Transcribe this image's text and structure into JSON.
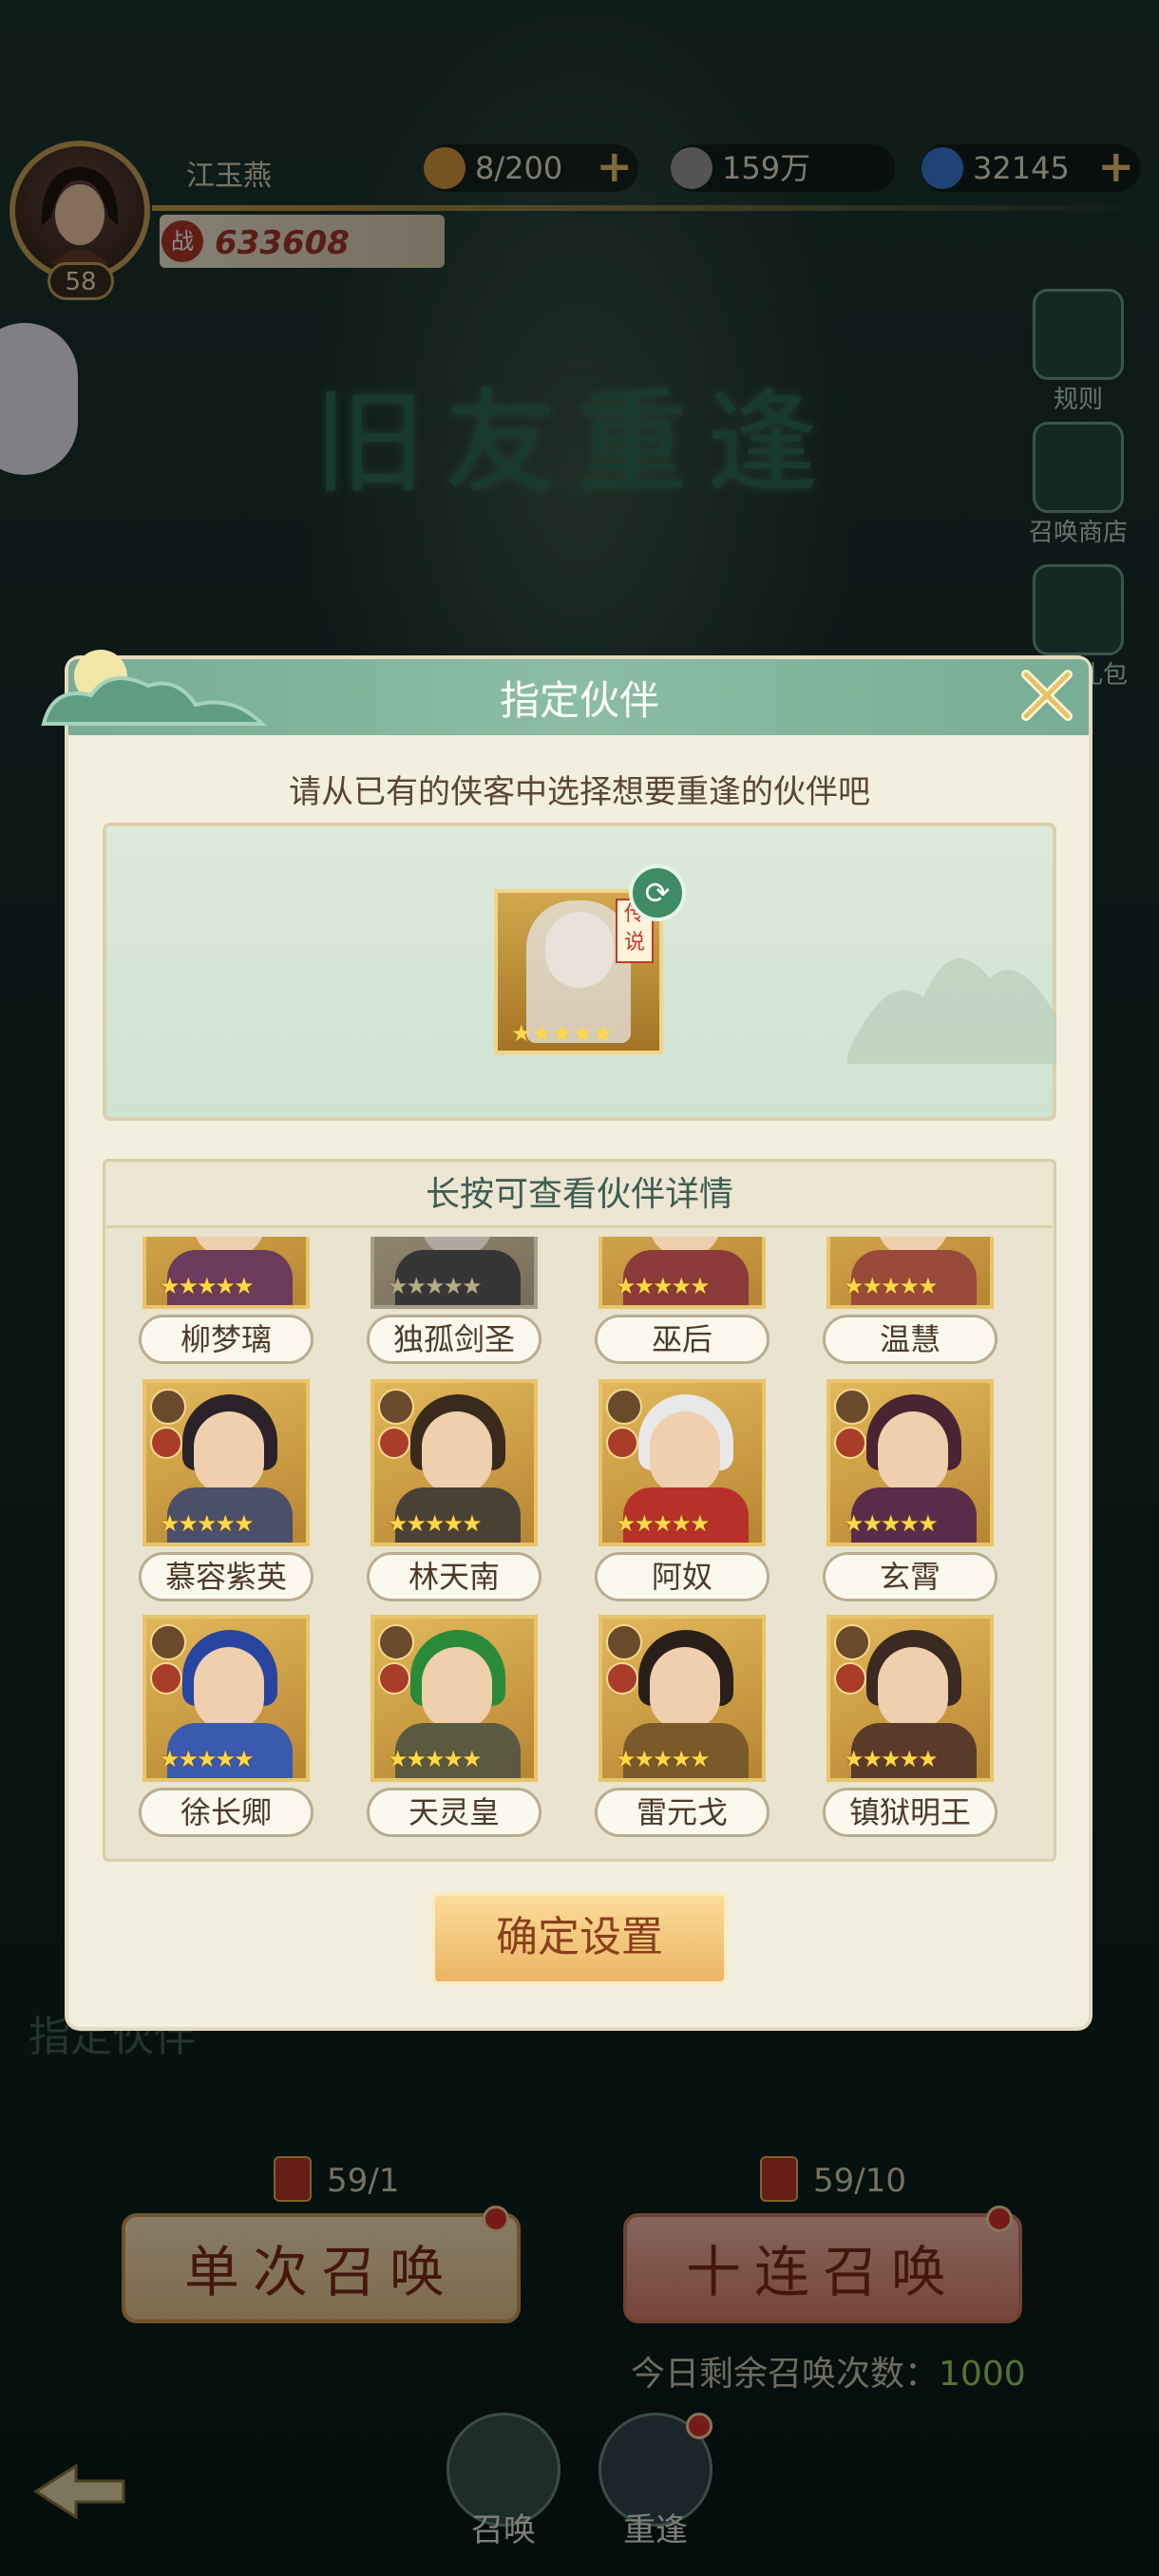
{
  "player": {
    "name": "江玉燕",
    "level": "58",
    "power": "633608",
    "power_icon": "战"
  },
  "resources": [
    {
      "id": "buns",
      "value": "8/200",
      "color": "#d89a3c"
    },
    {
      "id": "coins",
      "value": "159万",
      "color": "#9a9a9a"
    },
    {
      "id": "jade",
      "value": "32145",
      "color": "#3b7bd8"
    }
  ],
  "event_title": "旧友重逢",
  "side_menu": {
    "rules": "规则",
    "shop": "召唤商店",
    "gift": "限时礼包"
  },
  "modal": {
    "title": "指定伙伴",
    "subtitle": "请从已有的侠客中选择想要重逢的伙伴吧",
    "list_header": "长按可查看伙伴详情",
    "confirm": "确定设置",
    "legend_tag": "传说"
  },
  "partners": [
    {
      "name": "柳梦璃",
      "stars": "★★★★★",
      "legend": true,
      "hair": "#2b2330",
      "cloth": "#6c3a5c"
    },
    {
      "name": "独孤剑圣",
      "stars": "★★★★★",
      "legend": true,
      "selected": true,
      "hair": "#555",
      "cloth": "#444"
    },
    {
      "name": "巫后",
      "stars": "★★★★★",
      "legend": true,
      "hair": "#3a2a2a",
      "cloth": "#8c3a3a"
    },
    {
      "name": "温慧",
      "stars": "★★★★★",
      "legend": false,
      "hair": "#5a3522",
      "cloth": "#9a4a3a"
    },
    {
      "name": "慕容紫英",
      "stars": "★★★★★",
      "legend": false,
      "hair": "#2a2228",
      "cloth": "#4c4f6a"
    },
    {
      "name": "林天南",
      "stars": "★★★★★",
      "legend": false,
      "hair": "#3a2a1c",
      "cloth": "#4a4036"
    },
    {
      "name": "阿奴",
      "stars": "★★★★★",
      "legend": false,
      "hair": "#e8e8e8",
      "cloth": "#b8302a"
    },
    {
      "name": "玄霄",
      "stars": "★★★★★",
      "legend": false,
      "hair": "#4a2432",
      "cloth": "#5a2c4a"
    },
    {
      "name": "徐长卿",
      "stars": "★★★★★",
      "legend": false,
      "hair": "#2844a0",
      "cloth": "#3a5ab0"
    },
    {
      "name": "天灵皇",
      "stars": "★★★★★",
      "legend": false,
      "hair": "#2a8a3a",
      "cloth": "#5a5a40"
    },
    {
      "name": "雷元戈",
      "stars": "★★★★★",
      "legend": false,
      "hair": "#2a1e1a",
      "cloth": "#7a5a2a"
    },
    {
      "name": "镇狱明王",
      "stars": "★★★★★",
      "legend": false,
      "hair": "#3a2a22",
      "cloth": "#5a3a2a"
    }
  ],
  "bottom": {
    "specify_label": "指定伙伴",
    "single_count": "59/1",
    "ten_count": "59/10",
    "single_summon": "单次召唤",
    "ten_summon": "十连召唤",
    "daily_label": "今日剩余召唤次数：",
    "daily_value": "1000",
    "tab_summon": "召唤",
    "tab_reunion": "重逢"
  }
}
